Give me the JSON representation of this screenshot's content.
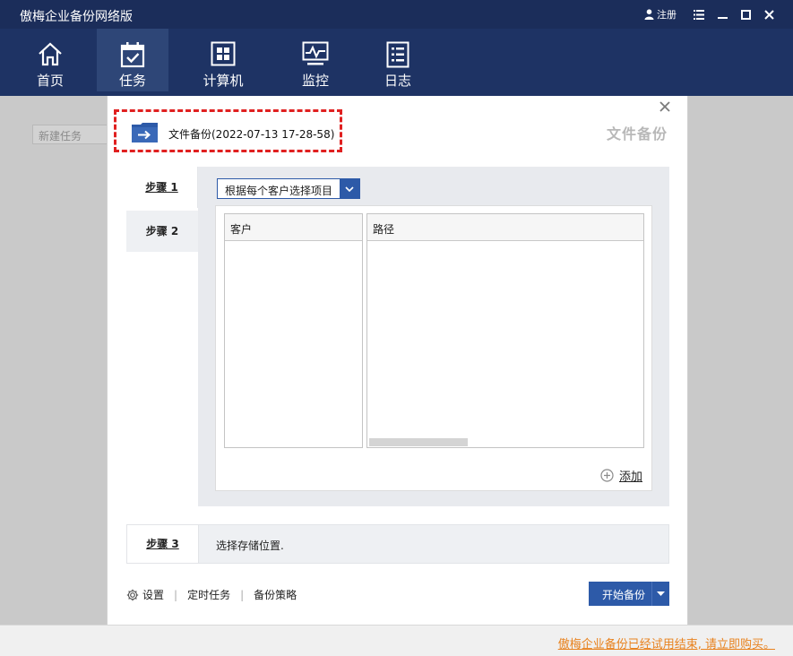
{
  "window": {
    "title": "傲梅企业备份网络版",
    "register_label": "注册"
  },
  "nav": [
    {
      "label": "首页",
      "icon": "home-icon"
    },
    {
      "label": "任务",
      "icon": "calendar-check-icon",
      "active": true
    },
    {
      "label": "计算机",
      "icon": "windows-icon"
    },
    {
      "label": "监控",
      "icon": "monitor-icon"
    },
    {
      "label": "日志",
      "icon": "log-icon"
    }
  ],
  "background": {
    "new_task_placeholder": "新建任务"
  },
  "dialog": {
    "type_label": "文件备份",
    "task_name": "文件备份(2022-07-13 17-28-58)",
    "step1_label": "步骤 1",
    "step2_label": "步骤 2",
    "step3_label": "步骤 3",
    "select_value": "根据每个客户选择项目",
    "columns": [
      "客户",
      "路径"
    ],
    "add_label": "添加",
    "step3_text": "选择存储位置.",
    "links": [
      "设置",
      "定时任务",
      "备份策略"
    ],
    "start_button": "开始备份"
  },
  "status": {
    "buy_message": "傲梅企业备份已经试用结束, 请立即购买。"
  },
  "colors": {
    "titlebar": "#1b2d5a",
    "navbar": "#1e3364",
    "accent": "#2d5aa8",
    "highlight_border": "#e02020",
    "warning_link": "#e8821e"
  }
}
